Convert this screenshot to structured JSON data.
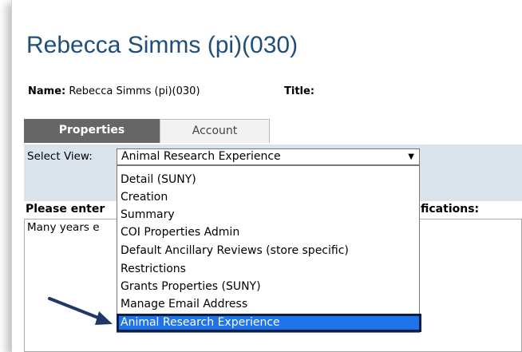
{
  "page": {
    "title": "Rebecca Simms (pi)(030)",
    "name_label": "Name:",
    "name_value": "Rebecca Simms (pi)(030)",
    "title_label": "Title:"
  },
  "tabs": [
    {
      "label": "Properties",
      "active": true
    },
    {
      "label": "Account",
      "active": false
    }
  ],
  "view": {
    "label": "Select View:",
    "selected": "Animal Research Experience",
    "options": [
      "Detail (SUNY)",
      "Creation",
      "Summary",
      "COI Properties Admin",
      "Default Ancillary Reviews (store specific)",
      "Restrictions",
      "Grants Properties (SUNY)",
      "Manage Email Address",
      "Animal Research Experience"
    ],
    "highlighted_option": "Animal Research Experience"
  },
  "form": {
    "prompt_left_visible": "Please enter",
    "prompt_right_visible": "fications:",
    "textarea_visible": "Many years e"
  },
  "colors": {
    "title": "#1f4e79",
    "tab_active_bg": "#666666",
    "band_bg": "#d9e3ec",
    "selected_option_bg": "#1e73e8",
    "selected_option_border": "#0a1e48",
    "annotation_arrow": "#1f3864"
  },
  "icons": {
    "select_arrow": "dropdown-triangle-icon",
    "annotation": "pointer-arrow-icon"
  }
}
